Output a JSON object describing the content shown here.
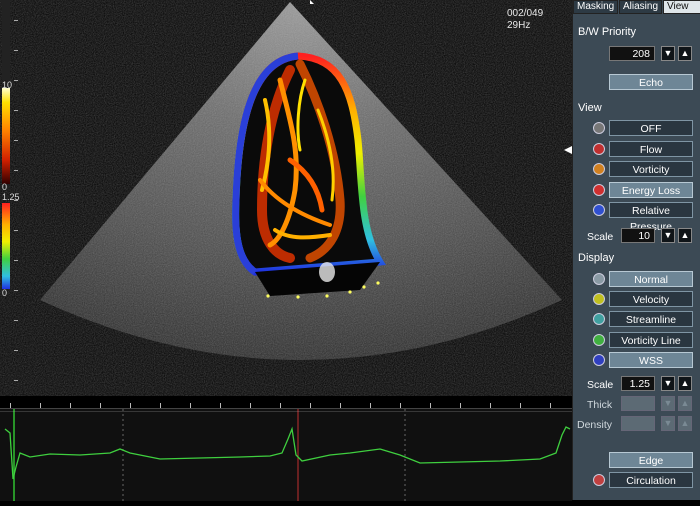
{
  "viewer": {
    "frame_counter": "002/049",
    "frame_rate": "29Hz",
    "flow_scale_top": "10",
    "flow_scale_bottom": "0",
    "velocity_scale_top": "1.25",
    "velocity_scale_bottom": "0"
  },
  "tabs": [
    {
      "label": "Masking"
    },
    {
      "label": "Aliasing"
    },
    {
      "label": "View"
    }
  ],
  "bw_priority": {
    "label": "B/W Priority",
    "value": "208",
    "echo_label": "Echo"
  },
  "view": {
    "title": "View",
    "items": [
      {
        "label": "OFF",
        "icon": "ghost-icon"
      },
      {
        "label": "Flow",
        "icon": "flow-icon"
      },
      {
        "label": "Vorticity",
        "icon": "vorticity-icon"
      },
      {
        "label": "Energy Loss",
        "icon": "energy-loss-icon"
      },
      {
        "label": "Relative Pressure",
        "icon": "pressure-icon"
      }
    ],
    "scale_label": "Scale",
    "scale_value": "10"
  },
  "display": {
    "title": "Display",
    "items": [
      {
        "label": "Normal",
        "icon": "normal-icon"
      },
      {
        "label": "Velocity",
        "icon": "velocity-icon"
      },
      {
        "label": "Streamline",
        "icon": "streamline-icon"
      },
      {
        "label": "Vorticity Line",
        "icon": "vorticity-line-icon"
      },
      {
        "label": "WSS",
        "icon": "wss-icon"
      }
    ],
    "scale_label": "Scale",
    "scale_value": "1.25",
    "thick_label": "Thick",
    "density_label": "Density"
  },
  "bottom": {
    "edge_label": "Edge",
    "circulation_label": "Circulation"
  },
  "colors": {
    "panel_bg": "#3c4a55",
    "button_on": "#6e8696",
    "ecg_trace": "#3fcf3f",
    "cavity_border": "#2a3fd8"
  }
}
